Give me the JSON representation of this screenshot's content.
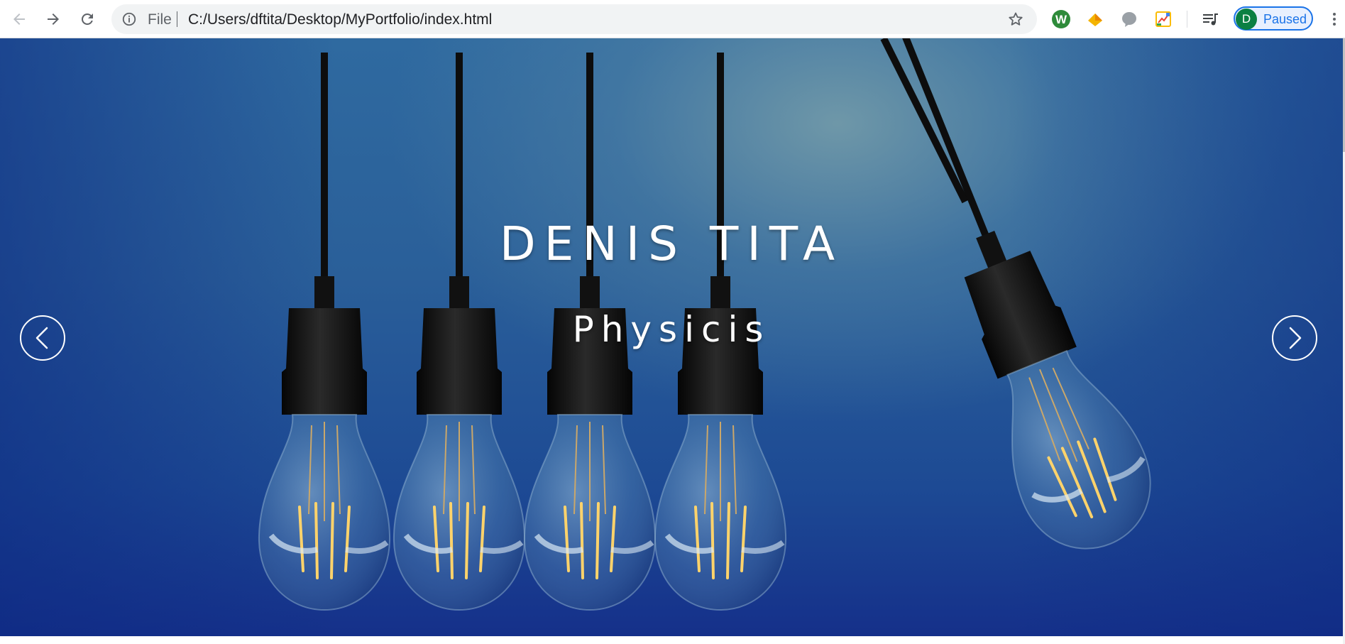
{
  "browser": {
    "file_label": "File",
    "url": "C:/Users/dftita/Desktop/MyPortfolio/index.html",
    "profile_initial": "D",
    "profile_status": "Paused",
    "icons": {
      "back": "back-arrow-icon",
      "forward": "forward-arrow-icon",
      "reload": "reload-icon",
      "info": "info-icon",
      "star": "bookmark-star-icon",
      "ext1": "w-extension-icon",
      "ext2": "diamond-extension-icon",
      "ext3": "chat-bubble-extension-icon",
      "ext4": "image-extension-icon",
      "media": "media-playlist-icon",
      "menu": "kebab-menu-icon"
    },
    "colors": {
      "accent": "#1a73e8",
      "omnibox_bg": "#f1f3f4"
    }
  },
  "hero": {
    "title": "DENIS TITA",
    "subtitle": "Physicis",
    "prev_icon": "chevron-left-icon",
    "next_icon": "chevron-right-icon",
    "background_colors": [
      "#2f6aa0",
      "#15308a"
    ]
  }
}
